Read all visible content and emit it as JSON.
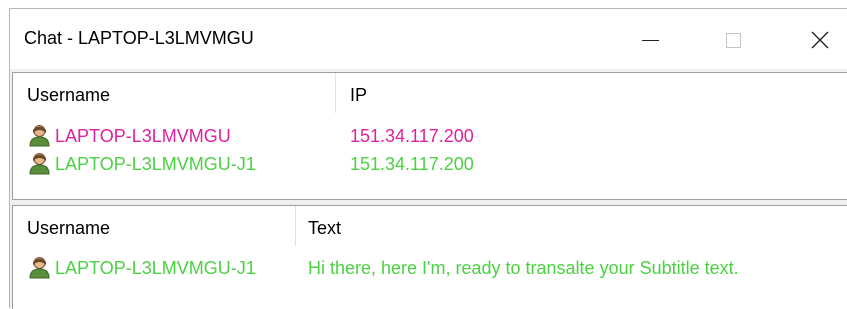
{
  "window": {
    "title": "Chat - LAPTOP-L3LMVMGU",
    "controls": {
      "minimize": "minimize",
      "maximize": "maximize",
      "close": "close"
    }
  },
  "users_list": {
    "columns": [
      "Username",
      "IP"
    ],
    "rows": [
      {
        "username": "LAPTOP-L3LMVMGU",
        "ip": "151.34.117.200",
        "color": "#e0219f",
        "icon": "user-icon"
      },
      {
        "username": "LAPTOP-L3LMVMGU-J1",
        "ip": "151.34.117.200",
        "color": "#4bd142",
        "icon": "user-icon"
      }
    ]
  },
  "messages_list": {
    "columns": [
      "Username",
      "Text"
    ],
    "rows": [
      {
        "username": "LAPTOP-L3LMVMGU-J1",
        "text": "Hi there, here I'm, ready to transalte your Subtitle text.",
        "color": "#4bd142",
        "icon": "user-icon"
      }
    ]
  }
}
